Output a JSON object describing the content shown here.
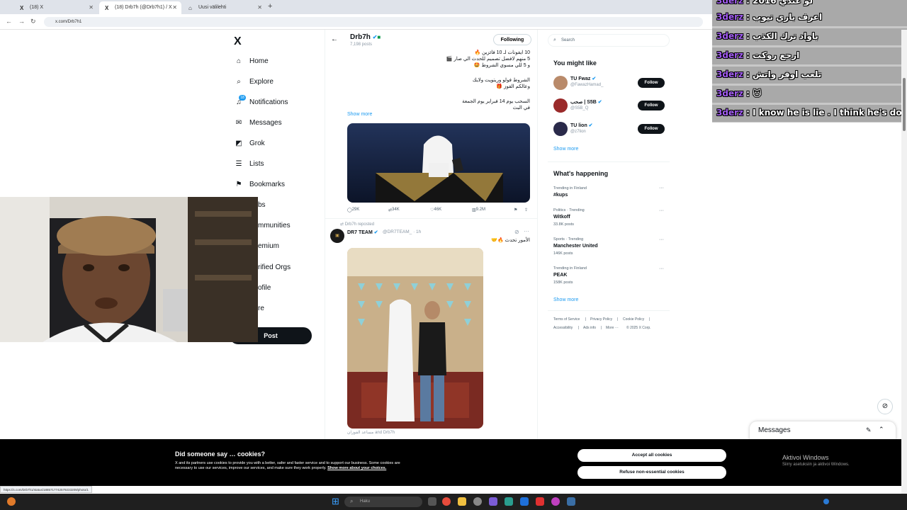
{
  "browser": {
    "tabs": [
      {
        "icon": "X",
        "title": "(18) X"
      },
      {
        "icon": "X",
        "title": "(18) Drb7h (@Drb7h1) / X"
      },
      {
        "icon": "⌂",
        "title": "Uusi välilehti"
      }
    ],
    "new_tab": "+",
    "url": "x.com/Drb7h1",
    "status_url": "https://x.com/Drb7h1/status/1885717742579233209/photo/1"
  },
  "nav": {
    "logo": "X",
    "items": [
      {
        "icon": "⌂",
        "label": "Home"
      },
      {
        "icon": "⌕",
        "label": "Explore"
      },
      {
        "icon": "♫",
        "label": "Notifications",
        "badge": "18"
      },
      {
        "icon": "✉",
        "label": "Messages"
      },
      {
        "icon": "◩",
        "label": "Grok"
      },
      {
        "icon": "☰",
        "label": "Lists"
      },
      {
        "icon": "⚑",
        "label": "Bookmarks"
      },
      {
        "icon": "",
        "label": "bs"
      },
      {
        "icon": "",
        "label": "mmunities"
      },
      {
        "icon": "",
        "label": "emium"
      },
      {
        "icon": "",
        "label": "rified Orgs"
      },
      {
        "icon": "",
        "label": "ofile"
      },
      {
        "icon": "",
        "label": "re"
      }
    ],
    "post_label": "Post"
  },
  "profile": {
    "back": "←",
    "name": "Drb7h",
    "posts": "7,198 posts",
    "following_label": "Following"
  },
  "tweet1": {
    "lines": [
      "10 ايفونات لـ 10 فائزين 🔥",
      "5 منهم لافضل تصميم للحدث الي صار 🎬",
      "و 5 للي مسوي الشروط 🤩",
      "الشروط فولو وريتويت ولايك",
      "وعالكم الفوز 🎁",
      "السحب يوم 14 فبراير يوم الجمعة",
      "في البث"
    ],
    "show_more": "Show more",
    "stats": {
      "replies": "29K",
      "reposts": "34K",
      "likes": "46K",
      "views": "9.2M"
    }
  },
  "tweet2": {
    "repost_label": "Drb7h reposted",
    "author": "DR7 TEAM",
    "handle": "@DR7TEAM_ · 1h",
    "text": "الأمور تحدث 🔥🤝",
    "caption": "مساعد الفوزان and Drb7h"
  },
  "right": {
    "search_placeholder": "Search",
    "suggest_title": "You might like",
    "suggestions": [
      {
        "name": "TU Fwaz",
        "handle": "@FawazHamad_",
        "follow": "Follow",
        "color": "#b98a6a"
      },
      {
        "name": "صحب | S5B",
        "handle": "@S5B_Q",
        "follow": "Follow",
        "color": "#9a2a2a"
      },
      {
        "name": "TU lion",
        "handle": "@z7lion",
        "follow": "Follow",
        "color": "#2a2a4a"
      }
    ],
    "show_more": "Show more",
    "happening_title": "What's happening",
    "trends": [
      {
        "context": "Trending in Finland",
        "title": "#kups",
        "count": ""
      },
      {
        "context": "Politics · Trending",
        "title": "Witkoff",
        "count": "33.8K posts"
      },
      {
        "context": "Sports · Trending",
        "title": "Manchester United",
        "count": "146K posts"
      },
      {
        "context": "Trending in Finland",
        "title": "PEAK",
        "count": "158K posts"
      }
    ],
    "show_more2": "Show more",
    "footer": [
      "Terms of Service",
      "|",
      "Privacy Policy",
      "|",
      "Cookie Policy",
      "|",
      "Accessibility",
      "|",
      "Ads info",
      "|",
      "More ···",
      "© 2025 X Corp."
    ]
  },
  "chat": {
    "lines": [
      {
        "name": "3derz",
        "text": " : لو عندي 2016"
      },
      {
        "name": "3derz",
        "text": " : اعرف باري تيوب"
      },
      {
        "name": "3derz",
        "text": " : باواد ترك الكذب"
      },
      {
        "name": "3derz",
        "text": " : ارجع روكت"
      },
      {
        "name": "3derz",
        "text": " : تلعب اوفر واتش"
      },
      {
        "name": "3derz",
        "text": " : 🐱"
      },
      {
        "name": "3derz",
        "text": " : I know he is lie . I think he's don"
      }
    ]
  },
  "dock": {
    "title": "Messages"
  },
  "cookie": {
    "title": "Did someone say … cookies?",
    "body": "X and its partners use cookies to provide you with a better, safer and faster service and to support our business. Some cookies are necessary to use our services, improve our services, and make sure they work properly.",
    "link": "Show more about your choices.",
    "accept": "Accept all cookies",
    "refuse": "Refuse non-essential cookies"
  },
  "windows": {
    "activate_title": "Aktivoi Windows",
    "activate_sub": "Siirry asetuksiin ja aktivoi Windows.",
    "search_placeholder": "Haku"
  }
}
